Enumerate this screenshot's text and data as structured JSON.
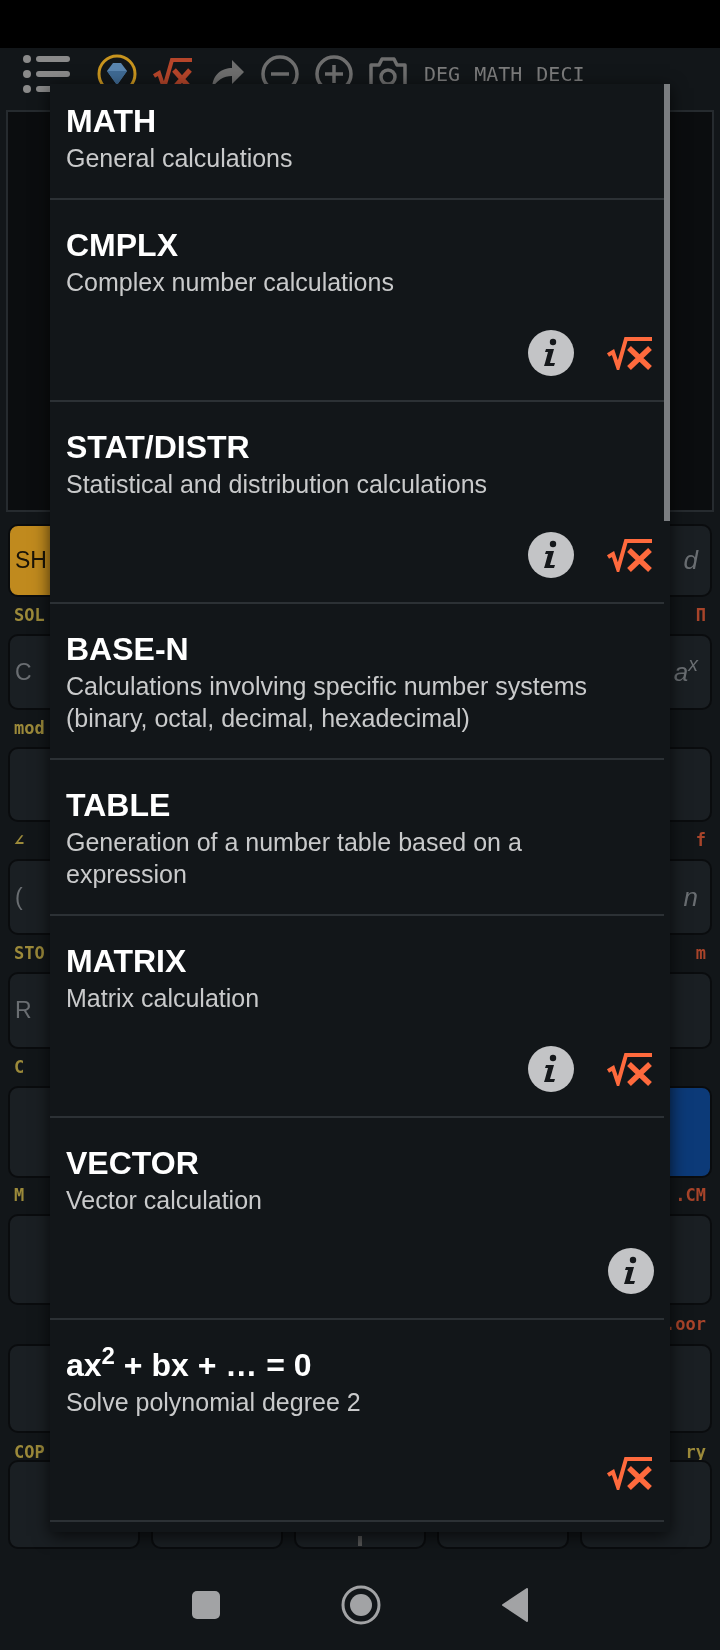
{
  "toolbar": {
    "modes": [
      "DEG",
      "MATH",
      "DECI"
    ]
  },
  "keypad": {
    "rows": [
      {
        "left": {
          "text": "SH",
          "kind": "shift"
        },
        "right": {
          "text": "d",
          "kind": "plain"
        },
        "left_caption": "SOL",
        "right_caption": "Π"
      },
      {
        "left": {
          "text": "C",
          "kind": "plain"
        },
        "right": {
          "text": "a$^{x}$",
          "kind": "plain"
        },
        "left_caption": "mod"
      },
      {
        "left": {
          "kind": "plain"
        },
        "right": {
          "kind": "plain"
        },
        "left_caption": "∠",
        "right_caption": "f"
      },
      {
        "left": {
          "text": "(",
          "kind": "plain"
        },
        "right": {
          "text": "n",
          "kind": "plain"
        },
        "left_caption": "STO",
        "right_caption": "m"
      },
      {
        "left": {
          "text": "R",
          "kind": "plain"
        },
        "right": {
          "kind": "plain"
        },
        "left_caption": "C"
      },
      {
        "left": {
          "kind": "plain"
        },
        "right": {
          "kind": "primary"
        },
        "left_caption": "M",
        "right_caption": ".CM"
      },
      {
        "left": {
          "kind": "plain"
        },
        "right": {
          "kind": "plain"
        },
        "right_caption": ".oor"
      },
      {
        "left": {
          "kind": "plain"
        },
        "right": {
          "kind": "plain"
        },
        "left_caption": "COP",
        "right_caption": "ry"
      }
    ]
  },
  "mode_menu": {
    "items": [
      {
        "title": "MATH",
        "subtitle": "General calculations",
        "info": false,
        "solver": false
      },
      {
        "title": "CMPLX",
        "subtitle": "Complex number calculations",
        "info": true,
        "solver": true
      },
      {
        "title": "STAT/DISTR",
        "subtitle": "Statistical and distribution calculations",
        "info": true,
        "solver": true
      },
      {
        "title": "BASE-N",
        "subtitle": "Calculations involving specific number systems (binary, octal, decimal, hexadecimal)",
        "info": false,
        "solver": false
      },
      {
        "title": "TABLE",
        "subtitle": "Generation of a number table based on a expression",
        "info": false,
        "solver": false
      },
      {
        "title": "MATRIX",
        "subtitle": "Matrix calculation",
        "info": true,
        "solver": true
      },
      {
        "title": "VECTOR",
        "subtitle": "Vector calculation",
        "info": true,
        "solver": false
      },
      {
        "title": "ax$^{2}$ + bx +  …  = 0",
        "subtitle": "Solve polynomial degree 2",
        "info": false,
        "solver": true
      }
    ]
  }
}
